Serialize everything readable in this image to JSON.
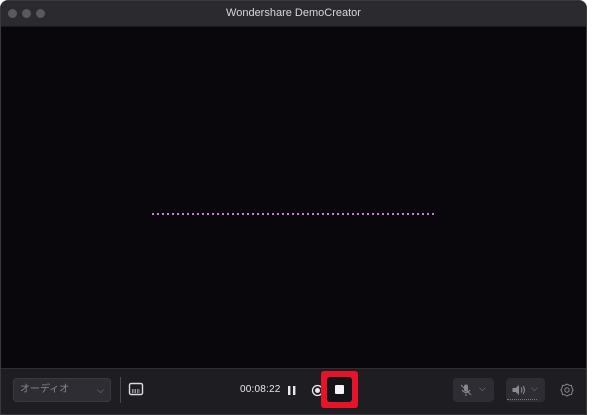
{
  "window": {
    "title": "Wondershare DemoCreator"
  },
  "toolbar": {
    "audio_select_value": "オーディオ",
    "timer": "00:08:22",
    "stop_button_highlighted": true,
    "highlight_color": "#e5142b"
  },
  "preview": {
    "waveform_color": "#c77ddc"
  },
  "icons": {
    "subtitle": "subtitle-icon",
    "pause": "pause-icon",
    "record": "record-icon",
    "stop": "stop-icon",
    "mic_muted": "mic-muted-icon",
    "speaker": "speaker-icon",
    "settings": "gear-icon"
  }
}
